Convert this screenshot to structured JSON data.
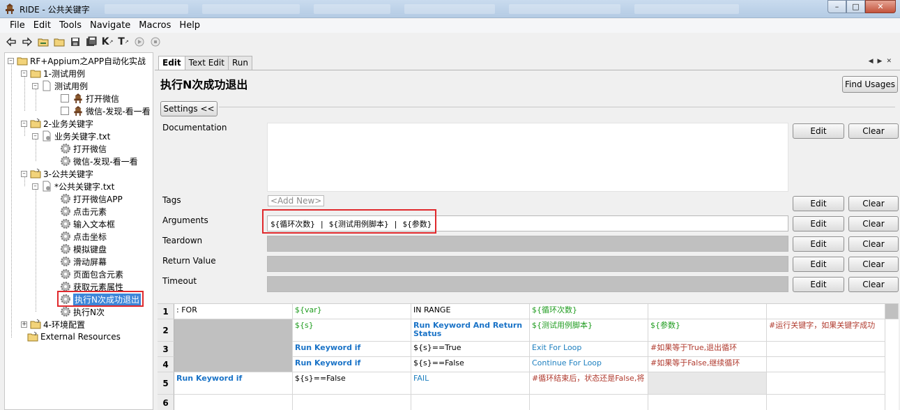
{
  "window": {
    "title": "RIDE - 公共关键字",
    "controls": [
      "minimize",
      "maximize",
      "close"
    ]
  },
  "menu": [
    "File",
    "Edit",
    "Tools",
    "Navigate",
    "Macros",
    "Help"
  ],
  "toolbar": {
    "icons": [
      "back-arrow-icon",
      "forward-arrow-icon",
      "open-project-icon",
      "open-folder-icon",
      "save-icon",
      "save-all-icon",
      "search-keywords-icon",
      "search-tests-icon",
      "run-icon",
      "stop-icon"
    ],
    "search_keywords_label": "K",
    "search_tests_label": "T"
  },
  "tree": {
    "root": "RF+Appium之APP自动化实战",
    "nodes": [
      {
        "label": "1-测试用例",
        "children_label": "测试用例",
        "tests": [
          "打开微信",
          "微信-发现-看一看"
        ]
      },
      {
        "label": "2-业务关键字",
        "file": "业务关键字.txt",
        "keywords": [
          "打开微信",
          "微信-发现-看一看"
        ]
      },
      {
        "label": "3-公共关键字",
        "file": "*公共关键字.txt",
        "keywords": [
          "打开微信APP",
          "点击元素",
          "输入文本框",
          "点击坐标",
          "模拟键盘",
          "滑动屏幕",
          "页面包含元素",
          "获取元素属性",
          "执行N次成功退出",
          "执行N次"
        ]
      },
      {
        "label": "4-环境配置"
      }
    ],
    "external": "External Resources",
    "selected": "执行N次成功退出"
  },
  "editor": {
    "tabs": [
      "Edit",
      "Text Edit",
      "Run"
    ],
    "active_tab": "Edit",
    "keyword_name": "执行N次成功退出",
    "find_usages": "Find Usages",
    "settings_toggle": "Settings <<",
    "edit_label": "Edit",
    "clear_label": "Clear",
    "labels": {
      "documentation": "Documentation",
      "tags": "Tags",
      "arguments": "Arguments",
      "teardown": "Teardown",
      "return_value": "Return Value",
      "timeout": "Timeout"
    },
    "tags_placeholder": "<Add New>",
    "arguments_value": "${循环次数} | ${测试用例脚本} | ${参数}"
  },
  "grid": {
    "row_numbers": [
      "1",
      "2",
      "3",
      "4",
      "5",
      "6"
    ],
    "rows": [
      [
        ": FOR",
        "${var}",
        "IN RANGE",
        "${循环次数}",
        "",
        ""
      ],
      [
        "",
        "${s}",
        "Run Keyword And Return Status",
        "${测试用例脚本}",
        "${参数}",
        "#运行关键字，如果关键字成功"
      ],
      [
        "",
        "Run Keyword if",
        "${s}==True",
        "Exit For Loop",
        "#如果等于True,退出循环",
        ""
      ],
      [
        "",
        "Run Keyword if",
        "${s}==False",
        "Continue For Loop",
        "#如果等于False,继续循环",
        ""
      ],
      [
        "Run Keyword if",
        "${s}==False",
        "FAIL",
        "#循环结束后，状态还是False,将",
        "",
        ""
      ],
      [
        "",
        "",
        "",
        "",
        "",
        ""
      ]
    ]
  },
  "colors": {
    "highlight_box": "#e0292c",
    "selection": "#3d86d9",
    "keyword": "#1a73c7",
    "variable": "#1f9c1f",
    "comment": "#b03a2e"
  }
}
